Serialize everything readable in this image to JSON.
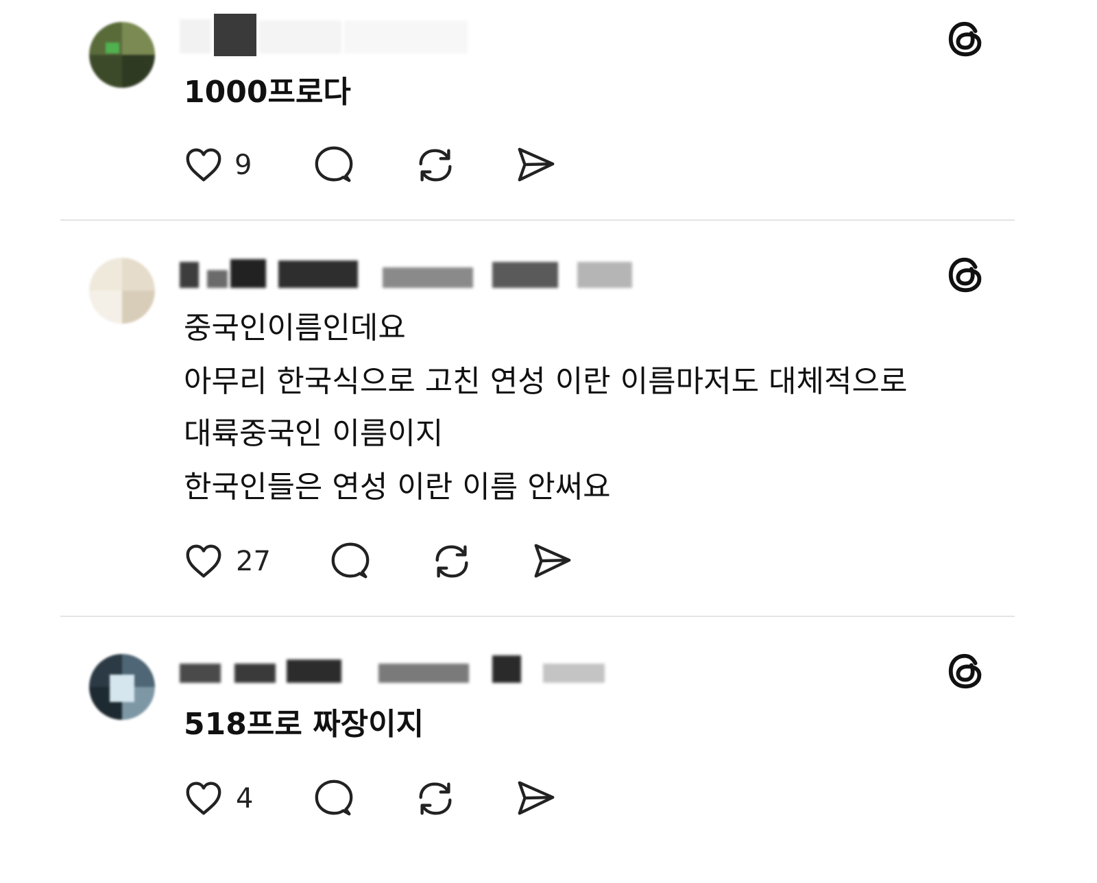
{
  "posts": [
    {
      "body": [
        "1000프로다"
      ],
      "likes": "9",
      "avatar_colors": [
        "#5a6b3a",
        "#3d4a2a",
        "#7b8a52",
        "#2f3a23",
        "#9aa06b",
        "#1e2618"
      ]
    },
    {
      "body": [
        "중국인이름인데요",
        "아무리 한국식으로 고친 연성 이란 이름마저도 대체적으로",
        "대륙중국인 이름이지",
        "한국인들은 연성 이란 이름 안써요"
      ],
      "likes": "27",
      "avatar_colors": [
        "#efe9dc",
        "#e6dccb",
        "#f4f0e8",
        "#d8cdb8",
        "#ece4d4",
        "#cbbfa6"
      ]
    },
    {
      "body": [
        "518프로 짜장이지"
      ],
      "likes": "4",
      "avatar_colors": [
        "#2b3a44",
        "#4e6675",
        "#d6e6ee",
        "#1d2a31",
        "#7d97a5",
        "#aac3cf"
      ]
    }
  ],
  "icons": {
    "threads": "threads-logo-icon",
    "like": "heart-icon",
    "reply": "comment-icon",
    "repost": "repost-icon",
    "share": "send-icon"
  }
}
